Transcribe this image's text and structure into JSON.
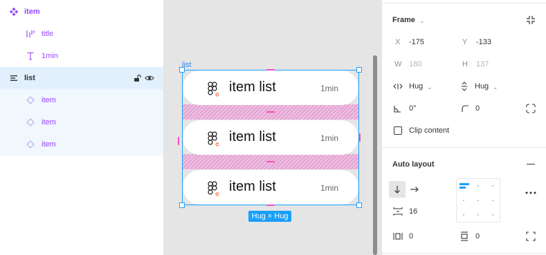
{
  "layers": {
    "component": "item",
    "title_layer": "title",
    "text_layer": "1min",
    "frame_layer": "list",
    "children": [
      "item",
      "item",
      "item"
    ]
  },
  "canvas": {
    "frame_label": "list",
    "items": [
      {
        "title": "item list",
        "time": "1min"
      },
      {
        "title": "item list",
        "time": "1min"
      },
      {
        "title": "item list",
        "time": "1min"
      }
    ],
    "size_badge": "Hug × Hug"
  },
  "props": {
    "frame_header": "Frame",
    "x_label": "X",
    "x_value": "-175",
    "y_label": "Y",
    "y_value": "-133",
    "w_label": "W",
    "w_value": "180",
    "h_label": "H",
    "h_value": "137",
    "width_mode": "Hug",
    "height_mode": "Hug",
    "rotation": "0°",
    "corner_radius": "0",
    "clip_content": "Clip content",
    "auto_layout_header": "Auto layout",
    "spacing": "16",
    "padding_h": "0",
    "padding_v": "0"
  },
  "colors": {
    "selection_blue": "#18a0fb",
    "component_purple": "#9747ff",
    "gap_pink": "#f24dbc"
  }
}
